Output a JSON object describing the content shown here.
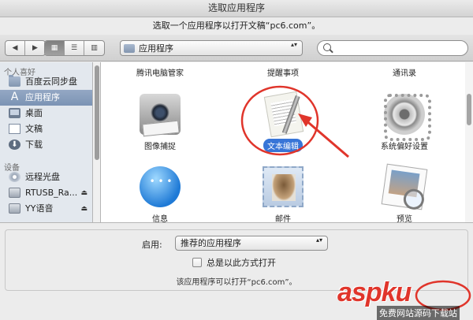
{
  "window": {
    "title": "选取应用程序"
  },
  "prompt": "选取一个应用程序以打开文稿“pc6.com”。",
  "toolbar": {
    "location": "应用程序",
    "nav_back": "◀",
    "nav_forward": "▶",
    "view_icon": "▦",
    "view_list": "☰",
    "view_column": "▥",
    "popup_arrows": "▴▾"
  },
  "sidebar": {
    "section_favorites": "个人喜好",
    "favorites": [
      {
        "label": "百度云同步盘",
        "icon": "folder-icon"
      },
      {
        "label": "应用程序",
        "icon": "applications-icon",
        "selected": true
      },
      {
        "label": "桌面",
        "icon": "desktop-icon"
      },
      {
        "label": "文稿",
        "icon": "documents-icon"
      },
      {
        "label": "下载",
        "icon": "downloads-icon"
      }
    ],
    "section_devices": "设备",
    "devices": [
      {
        "label": "远程光盘",
        "icon": "disc-icon"
      },
      {
        "label": "RTUSB_Ra...",
        "icon": "drive-icon",
        "eject": "⏏"
      },
      {
        "label": "YY语音",
        "icon": "drive-icon",
        "eject": "⏏"
      }
    ],
    "apps_glyph": "A",
    "downloads_glyph": "⬇"
  },
  "apps": {
    "row1": [
      "腾讯电脑管家",
      "提醒事项",
      "通讯录"
    ],
    "row2": [
      "图像捕捉",
      "文本编辑",
      "系统偏好设置"
    ],
    "row3": [
      "信息",
      "邮件",
      "预览"
    ],
    "selected": "文本编辑"
  },
  "bottom": {
    "enable_label": "启用:",
    "enable_value": "推荐的应用程序",
    "always_open_label": "总是以此方式打开",
    "info_text": "该应用程序可以打开“pc6.com”。"
  },
  "watermark": {
    "logo": "aspku",
    "subtitle": "免费网站源码下载站"
  },
  "colors": {
    "selection": "#3875d7",
    "annotation": "#e0352b",
    "sidebar_selected": "#7b93b4"
  }
}
